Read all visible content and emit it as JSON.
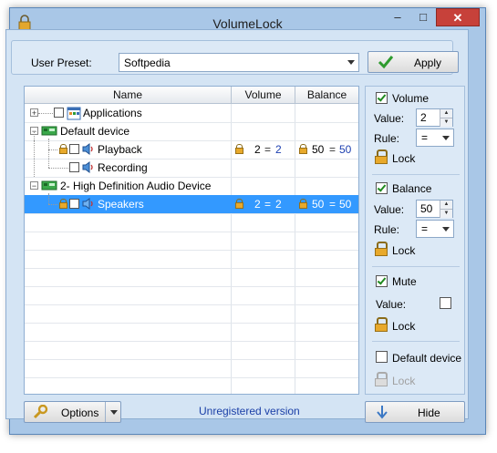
{
  "window": {
    "title": "VolumeLock",
    "controls": {
      "minimize": "–",
      "maximize": "□",
      "close": "✕"
    }
  },
  "preset": {
    "label": "User Preset:",
    "value": "Softpedia",
    "apply_label": "Apply"
  },
  "grid": {
    "headers": {
      "name": "Name",
      "volume": "Volume",
      "balance": "Balance"
    },
    "rows": [
      {
        "name": "Applications"
      },
      {
        "name": "Default device"
      },
      {
        "name": "Playback",
        "vol_a": "2",
        "vol_eq": "=",
        "vol_b": "2",
        "bal_a": "50",
        "bal_eq": "=",
        "bal_b": "50"
      },
      {
        "name": "Recording"
      },
      {
        "name": "2- High Definition Audio Device"
      },
      {
        "name": "Speakers",
        "vol_a": "2",
        "vol_eq": "=",
        "vol_b": "2",
        "bal_a": "50",
        "bal_eq": "=",
        "bal_b": "50"
      }
    ]
  },
  "side": {
    "volume": {
      "title": "Volume",
      "value_label": "Value:",
      "value": "2",
      "rule_label": "Rule:",
      "rule": "=",
      "lock_label": "Lock"
    },
    "balance": {
      "title": "Balance",
      "value_label": "Value:",
      "value": "50",
      "rule_label": "Rule:",
      "rule": "=",
      "lock_label": "Lock"
    },
    "mute": {
      "title": "Mute",
      "value_label": "Value:",
      "lock_label": "Lock"
    },
    "default_device": {
      "title": "Default device",
      "lock_label": "Lock"
    }
  },
  "footer": {
    "options_label": "Options",
    "status": "Unregistered version",
    "hide_label": "Hide"
  }
}
